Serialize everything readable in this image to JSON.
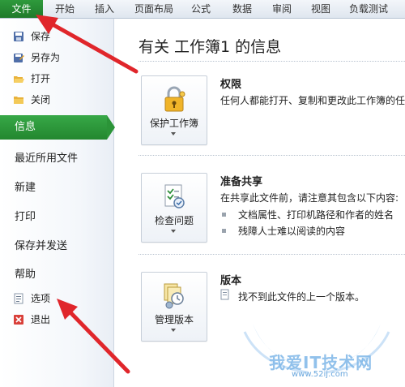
{
  "ribbon": {
    "file_tab": "文件",
    "tabs": [
      "开始",
      "插入",
      "页面布局",
      "公式",
      "数据",
      "审阅",
      "视图",
      "负载测试"
    ]
  },
  "left_pane": {
    "commands": [
      {
        "label": "保存",
        "icon": "save-icon"
      },
      {
        "label": "另存为",
        "icon": "save-as-icon"
      },
      {
        "label": "打开",
        "icon": "open-folder-icon"
      },
      {
        "label": "关闭",
        "icon": "close-folder-icon"
      }
    ],
    "nav": [
      "信息",
      "最近所用文件",
      "新建",
      "打印",
      "保存并发送",
      "帮助"
    ],
    "selected_nav": "信息",
    "bottom_commands": [
      {
        "label": "选项",
        "icon": "options-icon"
      },
      {
        "label": "退出",
        "icon": "exit-icon"
      }
    ]
  },
  "main": {
    "title": "有关 工作簿1 的信息",
    "sections": [
      {
        "button": "保护工作簿",
        "icon": "lock-key-icon",
        "heading": "权限",
        "text": "任何人都能打开、复制和更改此工作簿的任"
      },
      {
        "button": "检查问题",
        "icon": "checklist-icon",
        "heading": "准备共享",
        "text": "在共享此文件前，请注意其包含以下内容:",
        "bullets": [
          "文档属性、打印机路径和作者的姓名",
          "残障人士难以阅读的内容"
        ]
      },
      {
        "button": "管理版本",
        "icon": "versions-icon",
        "heading": "版本",
        "text": "找不到此文件的上一个版本。"
      }
    ]
  },
  "watermark": {
    "text": "我爱IT技术网",
    "url": "www.52ij.com"
  },
  "colors": {
    "accent_green": "#2b9438",
    "annotation_red": "#e0262b",
    "watermark_blue": "#7eb7e8"
  }
}
